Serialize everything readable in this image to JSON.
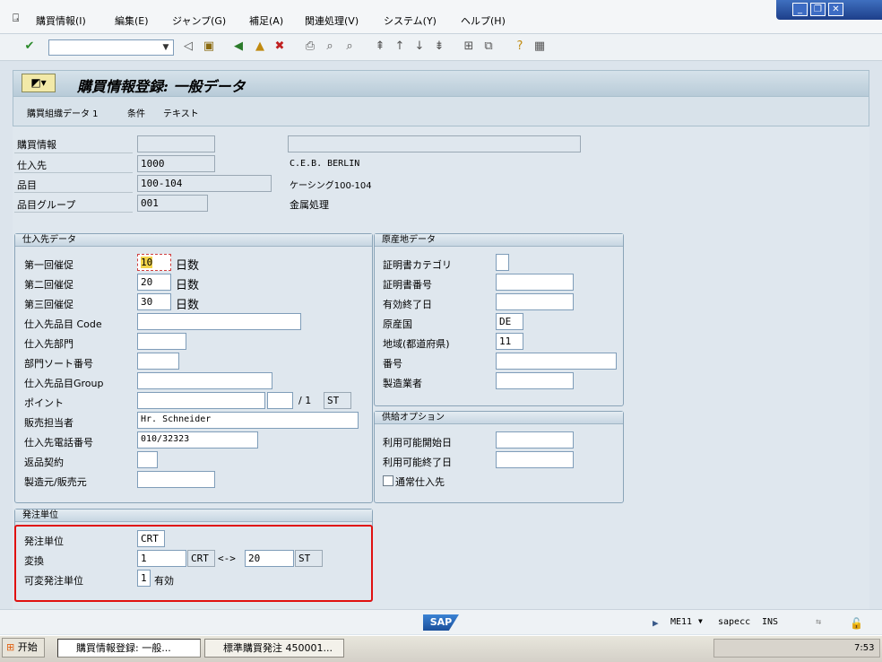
{
  "menu": [
    "購買情報(I)",
    "編集(E)",
    "ジャンプ(G)",
    "補足(A)",
    "関連処理(V)",
    "システム(Y)",
    "ヘルプ(H)"
  ],
  "title": "購買情報登録: 一般データ",
  "app_toolbar": [
    "購買組織データ 1",
    "条件",
    "テキスト"
  ],
  "header": {
    "info_label": "購買情報",
    "info_value": "",
    "info_desc": "",
    "vendor_label": "仕入先",
    "vendor_value": "1000",
    "vendor_desc": "C.E.B. BERLIN",
    "material_label": "品目",
    "material_value": "100-104",
    "material_desc": "ケーシング100-104",
    "matgroup_label": "品目グループ",
    "matgroup_value": "001",
    "matgroup_desc": "金属処理"
  },
  "vendor_data": {
    "title": "仕入先データ",
    "reminder1_label": "第一回催促",
    "reminder1_value": "10",
    "reminder2_label": "第二回催促",
    "reminder2_value": "20",
    "reminder3_label": "第三回催促",
    "reminder3_value": "30",
    "days_unit": "日数",
    "vend_mat_label": "仕入先品目 Code",
    "vend_mat_value": "",
    "sub_range_label": "仕入先部門",
    "sub_range_value": "",
    "sort_label": "部門ソート番号",
    "sort_value": "",
    "vend_matgrp_label": "仕入先品目Group",
    "vend_matgrp_value": "",
    "points_label": "ポイント",
    "points_value": "",
    "points_per": "",
    "points_slash": "/ 1",
    "points_unit": "ST",
    "salesperson_label": "販売担当者",
    "salesperson_value": "Hr. Schneider",
    "phone_label": "仕入先電話番号",
    "phone_value": "010/32323",
    "return_label": "返品契約",
    "return_value": "",
    "prod_label": "製造元/販売元",
    "prod_value": ""
  },
  "origin_data": {
    "title": "原産地データ",
    "cert_cat_label": "証明書カテゴリ",
    "cert_cat_value": "",
    "cert_no_label": "証明書番号",
    "cert_no_value": "",
    "valid_to_label": "有効終了日",
    "valid_to_value": "",
    "country_label": "原産国",
    "country_value": "DE",
    "region_label": "地域(都道府県)",
    "region_value": "11",
    "number_label": "番号",
    "number_value": "",
    "manufacturer_label": "製造業者",
    "manufacturer_value": ""
  },
  "supply_option": {
    "title": "供給オプション",
    "avail_from_label": "利用可能開始日",
    "avail_from_value": "",
    "avail_to_label": "利用可能終了日",
    "avail_to_value": "",
    "regular_label": "通常仕入先"
  },
  "order_unit": {
    "title": "発注単位",
    "unit_label": "発注単位",
    "unit_value": "CRT",
    "conv_label": "変換",
    "conv_num": "1",
    "conv_unit1": "CRT",
    "conv_arrow": "<->",
    "conv_den": "20",
    "conv_unit2": "ST",
    "var_label": "可変発注単位",
    "var_value": "1",
    "var_text": "有効"
  },
  "status": {
    "sap": "SAP",
    "tcode": "ME11",
    "system": "sapecc",
    "mode": "INS"
  },
  "taskbar": {
    "start": "开始",
    "task1": "購買情報登録: 一般...",
    "task2": "標準購買発注 450001...",
    "clock": "7:53"
  }
}
